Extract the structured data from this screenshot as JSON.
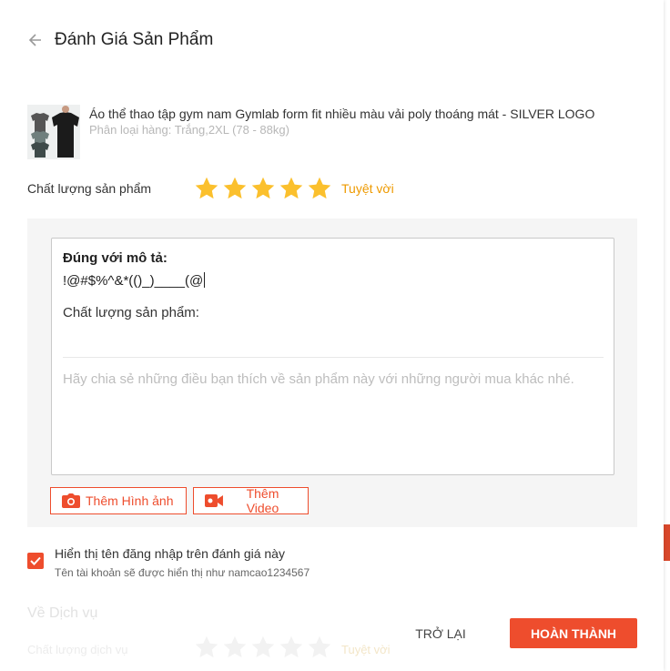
{
  "modal": {
    "title": "Đánh Giá Sản Phẩm"
  },
  "product": {
    "name": "Áo thể thao tập gym nam Gymlab form fit nhiều màu vải poly thoáng mát - SILVER LOGO",
    "variant": "Phân loại hàng: Trắng,2XL (78 - 88kg)"
  },
  "rating": {
    "label": "Chất lượng sản phẩm",
    "stars": 5,
    "max_stars": 5,
    "text": "Tuyệt vời",
    "color": "#fbc02d"
  },
  "review": {
    "field1_label": "Đúng với mô tả:",
    "field1_value": "!@#$%^&*(()_)____(@",
    "field2_label": "Chất lượng sản phẩm:",
    "placeholder": "Hãy chia sẻ những điều bạn thích về sản phẩm này với những người mua khác nhé."
  },
  "media": {
    "add_image": "Thêm Hình ảnh",
    "add_video": "Thêm Video"
  },
  "options": {
    "show_username": "Hiển thị tên đăng nhập trên đánh giá này",
    "username_hint": "Tên tài khoản sẽ được hiển thị như namcao1234567",
    "checked": true
  },
  "background": {
    "service_title": "Về Dịch vụ",
    "service_sub": "Chất lượng dịch vụ",
    "service_rating": "Tuyệt vời"
  },
  "actions": {
    "back": "TRỞ LẠI",
    "complete": "HOÀN THÀNH"
  },
  "colors": {
    "accent": "#ee4d2d",
    "star": "#fbc02d",
    "rating_text": "#ee9a00"
  }
}
